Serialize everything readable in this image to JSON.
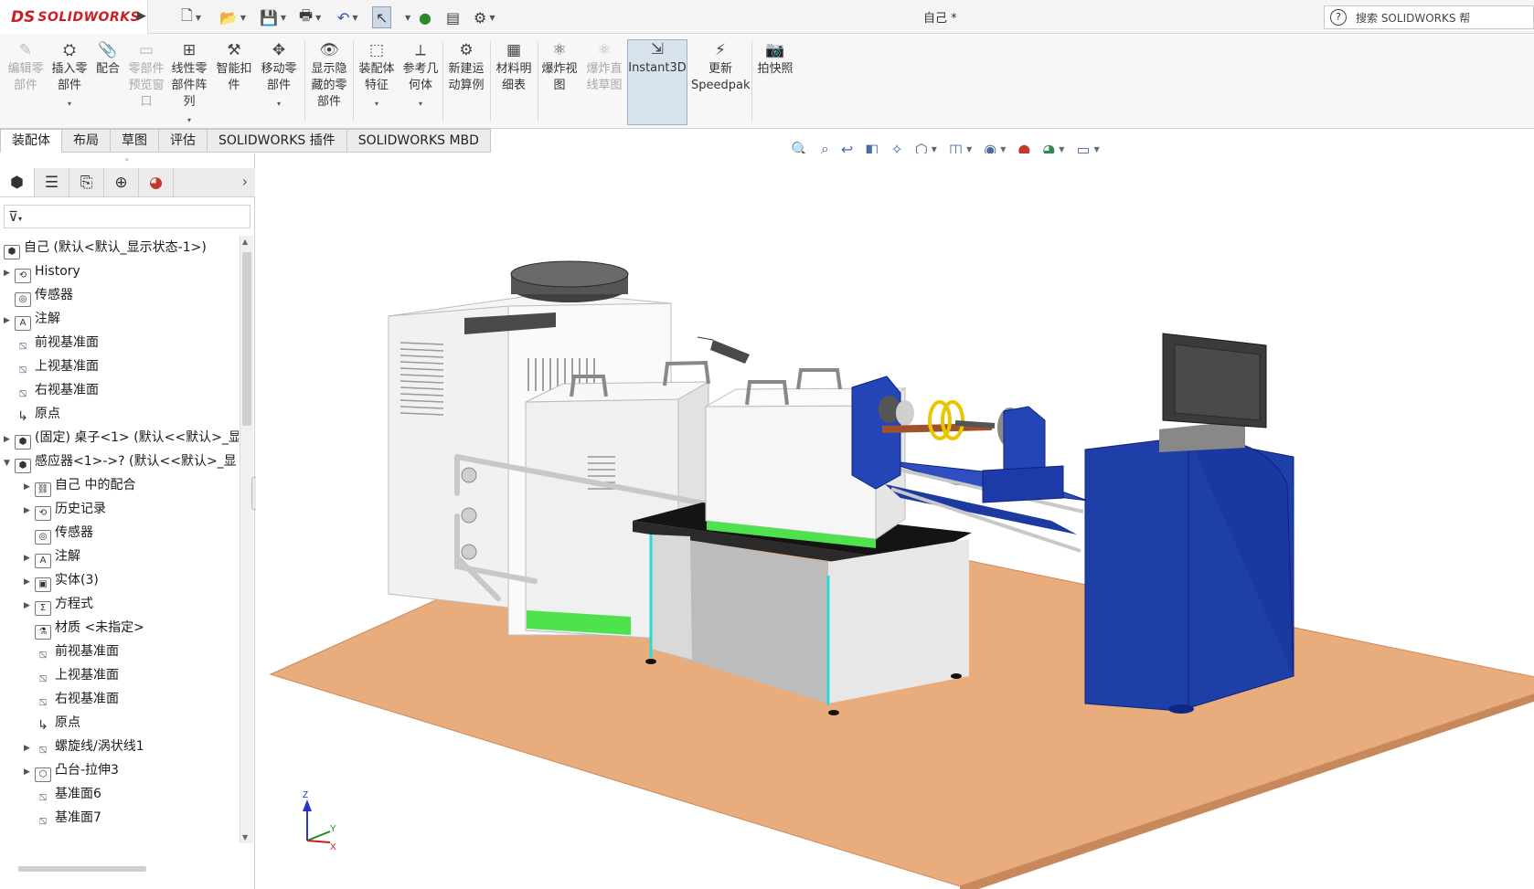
{
  "app": {
    "logo_ds": "DS",
    "logo_name": "SOLIDWORKS",
    "document_title": "自己 *",
    "search_placeholder": "搜索 SOLIDWORKS 帮"
  },
  "quick_access": [
    {
      "name": "new-doc-icon",
      "icon": "🗋"
    },
    {
      "name": "open-icon",
      "icon": "📂"
    },
    {
      "name": "save-icon",
      "icon": "💾"
    },
    {
      "name": "print-icon",
      "icon": "🖶"
    },
    {
      "name": "undo-icon",
      "icon": "↶"
    },
    {
      "name": "select-icon",
      "icon": "↖"
    },
    {
      "name": "traffic-light-icon",
      "icon": "🚦"
    },
    {
      "name": "file-properties-icon",
      "icon": "▤"
    },
    {
      "name": "options-gear-icon",
      "icon": "⚙"
    }
  ],
  "ribbon": {
    "edit_component": "编辑零\n部件",
    "insert_components": "插入零\n部件",
    "mate": "配合",
    "component_preview": "零部件\n预览窗\n口",
    "linear_pattern": "线性零\n部件阵\n列",
    "smart_fasteners": "智能扣\n件",
    "move_component": "移动零\n部件",
    "show_hidden": "显示隐\n藏的零\n部件",
    "assembly_features": "装配体\n特征",
    "reference_geometry": "参考几\n何体",
    "new_motion_study": "新建运\n动算例",
    "bill_of_materials": "材料明\n细表",
    "exploded_view": "爆炸视\n图",
    "explode_line_sketch": "爆炸直\n线草图",
    "instant3d": "Instant3D",
    "update_speedpak": "更新\nSpeedpak",
    "take_snapshot": "拍快照"
  },
  "tabs": [
    "装配体",
    "布局",
    "草图",
    "评估",
    "SOLIDWORKS 插件",
    "SOLIDWORKS MBD"
  ],
  "panel_tabs": [
    "feature-manager-icon",
    "property-manager-icon",
    "configuration-manager-icon",
    "dimxpert-icon",
    "display-manager-icon"
  ],
  "tree": {
    "root": "自己 (默认<默认_显示状态-1>)",
    "items": [
      {
        "label": "History",
        "expand": true,
        "icon": "history"
      },
      {
        "label": "传感器",
        "expand": false,
        "icon": "sensor"
      },
      {
        "label": "注解",
        "expand": true,
        "icon": "annotation"
      },
      {
        "label": "前视基准面",
        "expand": false,
        "icon": "plane"
      },
      {
        "label": "上视基准面",
        "expand": false,
        "icon": "plane"
      },
      {
        "label": "右视基准面",
        "expand": false,
        "icon": "plane"
      },
      {
        "label": "原点",
        "expand": false,
        "icon": "origin"
      },
      {
        "label": "(固定) 桌子<1> (默认<<默认>_显",
        "expand": true,
        "icon": "part"
      },
      {
        "label": "感应器<1>->? (默认<<默认>_显",
        "expand": true,
        "icon": "part",
        "open": true
      },
      {
        "label": "自己 中的配合",
        "expand": true,
        "icon": "mates",
        "indent": 1
      },
      {
        "label": "历史记录",
        "expand": true,
        "icon": "history",
        "indent": 1
      },
      {
        "label": "传感器",
        "expand": false,
        "icon": "sensor",
        "indent": 1
      },
      {
        "label": "注解",
        "expand": true,
        "icon": "annotation",
        "indent": 1
      },
      {
        "label": "实体(3)",
        "expand": true,
        "icon": "solid",
        "indent": 1
      },
      {
        "label": "方程式",
        "expand": true,
        "icon": "equation",
        "indent": 1
      },
      {
        "label": "材质 <未指定>",
        "expand": false,
        "icon": "material",
        "indent": 1
      },
      {
        "label": "前视基准面",
        "expand": false,
        "icon": "plane",
        "indent": 1
      },
      {
        "label": "上视基准面",
        "expand": false,
        "icon": "plane",
        "indent": 1
      },
      {
        "label": "右视基准面",
        "expand": false,
        "icon": "plane",
        "indent": 1
      },
      {
        "label": "原点",
        "expand": false,
        "icon": "origin",
        "indent": 1
      },
      {
        "label": "螺旋线/涡状线1",
        "expand": true,
        "icon": "plane",
        "indent": 1
      },
      {
        "label": "凸台-拉伸3",
        "expand": true,
        "icon": "extrude",
        "indent": 1
      },
      {
        "label": "基准面6",
        "expand": false,
        "icon": "plane",
        "indent": 1
      },
      {
        "label": "基准面7",
        "expand": false,
        "icon": "plane",
        "indent": 1
      }
    ]
  },
  "axis": {
    "x": "X",
    "y": "Y",
    "z": "Z"
  },
  "colors": {
    "floor": "#e9ac7c",
    "machine_blue": "#1d3fa3",
    "chiller_white": "#f3f3f3",
    "table_top": "#141414",
    "foot_green": "#4ee24e",
    "accent_red": "#cc1f24"
  }
}
